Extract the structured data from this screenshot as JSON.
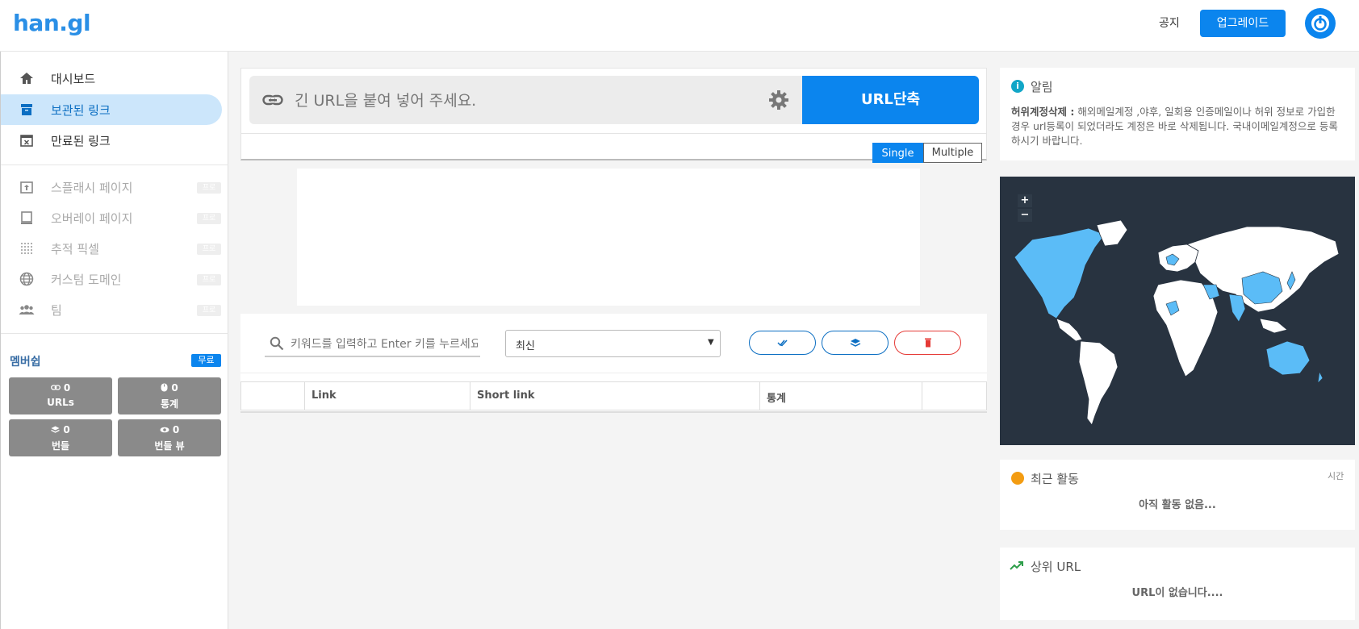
{
  "header": {
    "logo": "han.gl",
    "notice": "공지",
    "upgrade": "업그레이드"
  },
  "sidebar": {
    "items": [
      {
        "label": "대시보드",
        "icon": "home-icon"
      },
      {
        "label": "보관된 링크",
        "icon": "archive-icon"
      },
      {
        "label": "만료된 링크",
        "icon": "calendar-x-icon"
      },
      {
        "label": "스플래시 페이지",
        "icon": "splash-icon",
        "badge": "프로"
      },
      {
        "label": "오버레이 페이지",
        "icon": "overlay-icon",
        "badge": "프로"
      },
      {
        "label": "추적 픽셀",
        "icon": "pixel-icon",
        "badge": "프로"
      },
      {
        "label": "커스텀 도메인",
        "icon": "globe-icon",
        "badge": "프로"
      },
      {
        "label": "팀",
        "icon": "team-icon",
        "badge": "프로"
      }
    ],
    "membership": {
      "title": "멤버쉽",
      "badge": "무료",
      "stats": [
        {
          "value": "0",
          "label": "URLs",
          "icon": "link-icon"
        },
        {
          "value": "0",
          "label": "통계",
          "icon": "mouse-icon"
        },
        {
          "value": "0",
          "label": "번들",
          "icon": "layers-icon"
        },
        {
          "value": "0",
          "label": "번들 뷰",
          "icon": "eye-icon"
        }
      ]
    }
  },
  "shortener": {
    "placeholder": "긴 URL을 붙여 넣어 주세요.",
    "button": "URL단축",
    "mode_single": "Single",
    "mode_multiple": "Multiple"
  },
  "links": {
    "search_placeholder": "키워드를 입력하고 Enter 키를 누르세요",
    "sort_value": "최신",
    "columns": [
      "",
      "Link",
      "Short link",
      "통계",
      ""
    ]
  },
  "right": {
    "notice_title": "알림",
    "notice_bold": "허위계정삭제 :",
    "notice_text": " 해외메일계정 ,야후, 일회용 인증메일이나 허위 정보로 가입한 경우 url등록이 되었더라도 계정은 바로 삭제됩니다. 국내이메일계정으로 등록하시기 바랍니다.",
    "map_zoom_in": "+",
    "map_zoom_out": "−",
    "activity_title": "최근 활동",
    "activity_time": "시간",
    "activity_empty": "아직 활동 없음...",
    "top_title": "상위 URL",
    "top_empty": "URL이 없습니다...."
  },
  "colors": {
    "accent": "#0b85ee",
    "map_bg": "#283340",
    "map_highlight": "#5bbcf7"
  }
}
